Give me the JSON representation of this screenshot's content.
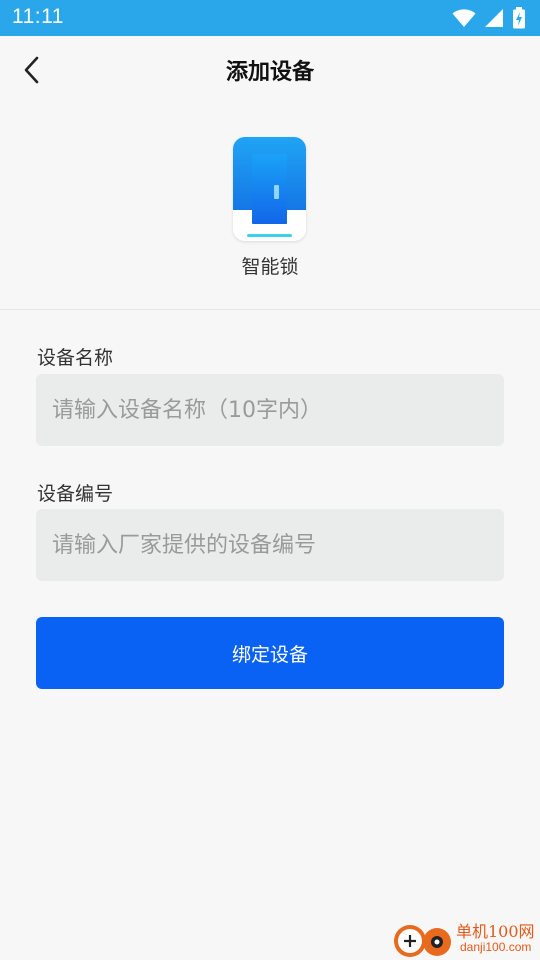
{
  "status_bar": {
    "time": "11:11",
    "icons": [
      "wifi-icon",
      "signal-icon",
      "battery-charging-icon"
    ],
    "background": "#2aa7ea"
  },
  "header": {
    "title": "添加设备",
    "back_icon": "chevron-left-icon"
  },
  "device": {
    "name": "智能锁",
    "icon": "smart-lock-icon"
  },
  "form": {
    "device_name": {
      "label": "设备名称",
      "value": "",
      "placeholder": "请输入设备名称（10字内）"
    },
    "device_number": {
      "label": "设备编号",
      "value": "",
      "placeholder": "请输入厂家提供的设备编号"
    },
    "submit_label": "绑定设备"
  },
  "colors": {
    "primary": "#0a62f5",
    "input_bg": "#eaecec",
    "page_bg": "#f7f7f7"
  },
  "watermark": {
    "name": "单机100网",
    "url": "danji100.com"
  }
}
